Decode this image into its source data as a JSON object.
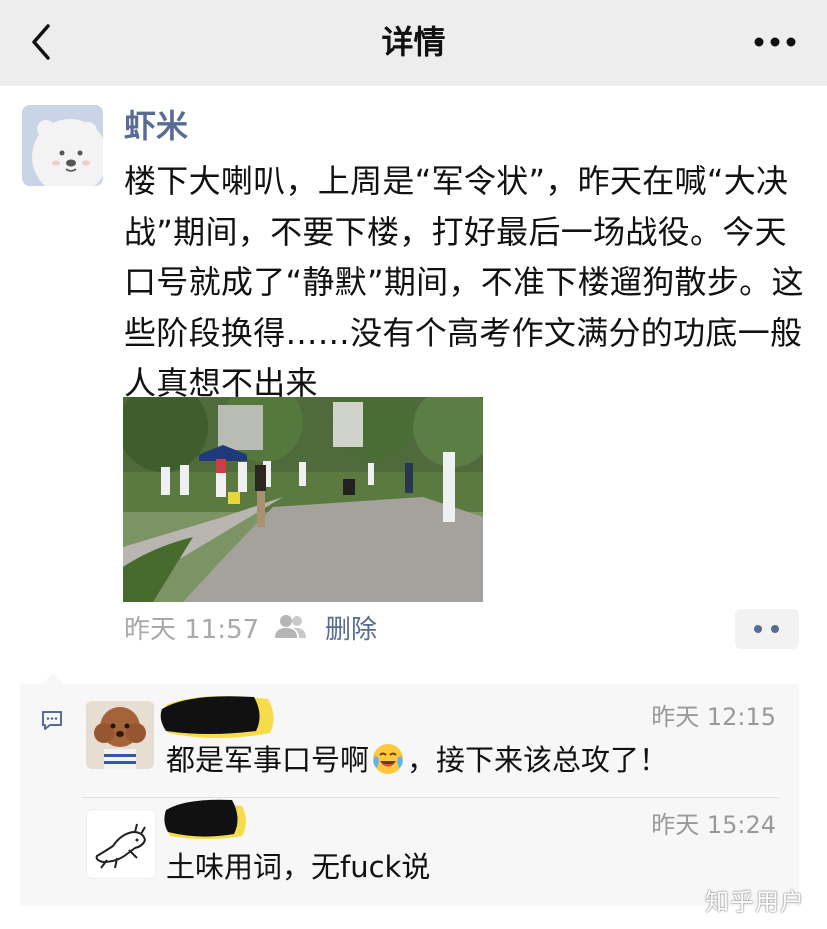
{
  "navbar": {
    "title": "详情",
    "back_icon": "chevron-left-icon",
    "more_icon": "more-dots-icon"
  },
  "post": {
    "author": "虾米",
    "text": "楼下大喇叭，上周是“军令状”，昨天在喊“大决战”期间，不要下楼，打好最后一场战役。今天口号就成了“静默”期间，不准下楼遛狗散步。这些阶段换得……没有个高考作文满分的功底一般人真想不出来",
    "time": "昨天 11:57",
    "delete_label": "删除",
    "visibility_icon": "people-icon"
  },
  "comments": [
    {
      "time": "昨天 12:15",
      "text_before": "都是军事口号啊",
      "emoji": "crying-laughing-emoji",
      "text_after": "，接下来该总攻了！"
    },
    {
      "time": "昨天 15:24",
      "text_before": "土味用词，无fuck说",
      "emoji": "",
      "text_after": ""
    }
  ],
  "watermark": "知乎用户",
  "colors": {
    "navbar_bg": "#ededed",
    "link_blue": "#576b95",
    "meta_gray": "#a9a9a9",
    "comment_bg": "#f7f7f7"
  }
}
